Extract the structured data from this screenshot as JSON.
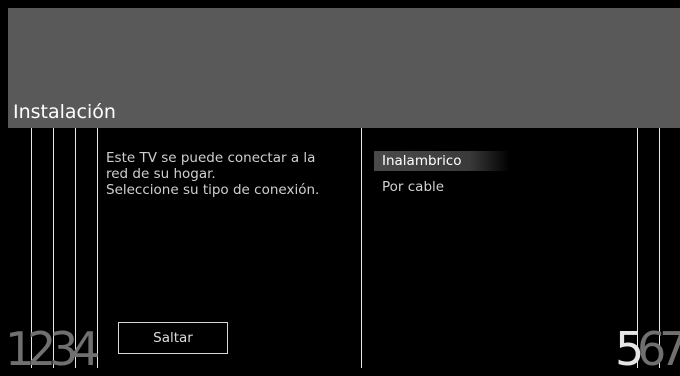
{
  "screen": {
    "title": "Instalación",
    "description": "Este TV se puede conectar a la\nred de su hogar.\nSeleccione su tipo de conexión.",
    "skip_label": "Saltar"
  },
  "options": [
    {
      "label": "Inalambrico",
      "selected": true
    },
    {
      "label": "Por cable",
      "selected": false
    }
  ],
  "steps": {
    "left": [
      "1",
      "2",
      "3",
      "4"
    ],
    "right": [
      "5",
      "6",
      "7"
    ],
    "current": "5"
  },
  "colors": {
    "header_band": "#595959",
    "background": "#000000",
    "selected_option": "#4a4a4a"
  }
}
